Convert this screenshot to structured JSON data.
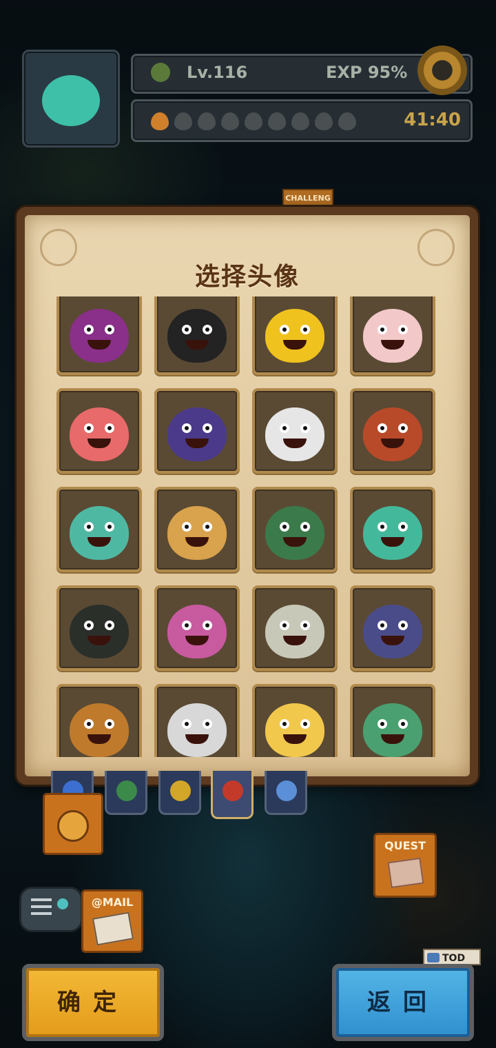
{
  "hud": {
    "level": "Lv.116",
    "exp": "EXP  95%",
    "timer": "41:40",
    "stamina_total": 9,
    "stamina_filled": 1
  },
  "panel": {
    "title": "选择头像"
  },
  "avatars": [
    {
      "name": "crystal-demon-avatar",
      "color": "#8a2f8a"
    },
    {
      "name": "top-hat-shadow-avatar",
      "color": "#232323"
    },
    {
      "name": "yellow-gift-box-avatar",
      "color": "#f0c21e"
    },
    {
      "name": "pink-gift-box-avatar",
      "color": "#f2c8c8"
    },
    {
      "name": "pink-slime-avatar",
      "color": "#e86a6a"
    },
    {
      "name": "purple-knight-avatar",
      "color": "#4b3a8a"
    },
    {
      "name": "white-blob-avatar",
      "color": "#e6e6e6"
    },
    {
      "name": "red-ogre-avatar",
      "color": "#b84a2a"
    },
    {
      "name": "silver-hair-avatar",
      "color": "#4fb8a3"
    },
    {
      "name": "horned-mage-avatar",
      "color": "#d9a24c"
    },
    {
      "name": "tentacle-winged-avatar",
      "color": "#3b7a4a"
    },
    {
      "name": "green-zombie-avatar",
      "color": "#44b89a"
    },
    {
      "name": "plague-doctor-avatar",
      "color": "#2b2f2a"
    },
    {
      "name": "fan-dancer-avatar",
      "color": "#c85aa0"
    },
    {
      "name": "armored-knight-avatar",
      "color": "#c8c8b8"
    },
    {
      "name": "winged-vampire-avatar",
      "color": "#4a4c8a"
    },
    {
      "name": "scarecrow-avatar",
      "color": "#c07a2c"
    },
    {
      "name": "white-hair-hatter-avatar",
      "color": "#d8d8d8"
    },
    {
      "name": "golden-princess-avatar",
      "color": "#f2c84c"
    },
    {
      "name": "jade-lion-avatar",
      "color": "#4aa070"
    }
  ],
  "tabs": [
    {
      "name": "tab-blue-category",
      "color": "#3d6fd0"
    },
    {
      "name": "tab-green-category",
      "color": "#3c8a4a"
    },
    {
      "name": "tab-yellow-category",
      "color": "#d2a628"
    },
    {
      "name": "tab-red-category",
      "color": "#c43a2a"
    },
    {
      "name": "tab-unknown-category",
      "color": "#5b8fd8"
    }
  ],
  "side": {
    "challenge_label": "CHALLENG",
    "quest_label": "QUEST",
    "mail_label": "@MAIL",
    "tod_label": "TOD"
  },
  "buttons": {
    "confirm": "确定",
    "back": "返回"
  },
  "colors": {
    "panel_parchment": "#e2cba2",
    "panel_frame": "#5b3a20",
    "confirm_button": "#e9a626",
    "back_button": "#3d9fd8"
  }
}
